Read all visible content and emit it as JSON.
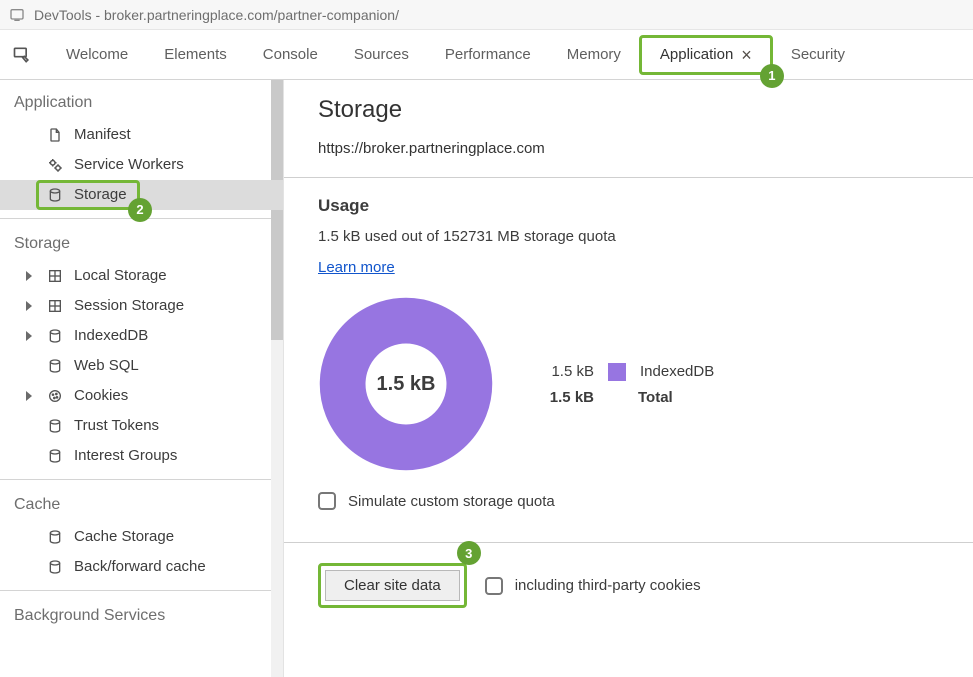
{
  "window": {
    "title": "DevTools - broker.partneringplace.com/partner-companion/"
  },
  "tabs": {
    "items": [
      {
        "label": "Welcome"
      },
      {
        "label": "Elements"
      },
      {
        "label": "Console"
      },
      {
        "label": "Sources"
      },
      {
        "label": "Performance"
      },
      {
        "label": "Memory"
      },
      {
        "label": "Application"
      },
      {
        "label": "Security"
      }
    ]
  },
  "badges": {
    "b1": "1",
    "b2": "2",
    "b3": "3"
  },
  "sidebar": {
    "application": {
      "heading": "Application",
      "items": [
        {
          "label": "Manifest"
        },
        {
          "label": "Service Workers"
        },
        {
          "label": "Storage"
        }
      ]
    },
    "storage": {
      "heading": "Storage",
      "items": [
        {
          "label": "Local Storage"
        },
        {
          "label": "Session Storage"
        },
        {
          "label": "IndexedDB"
        },
        {
          "label": "Web SQL"
        },
        {
          "label": "Cookies"
        },
        {
          "label": "Trust Tokens"
        },
        {
          "label": "Interest Groups"
        }
      ]
    },
    "cache": {
      "heading": "Cache",
      "items": [
        {
          "label": "Cache Storage"
        },
        {
          "label": "Back/forward cache"
        }
      ]
    },
    "background": {
      "heading": "Background Services"
    }
  },
  "panel": {
    "title": "Storage",
    "origin": "https://broker.partneringplace.com",
    "usage_heading": "Usage",
    "usage_line": "1.5 kB used out of 152731 MB storage quota",
    "learn_more": "Learn more",
    "donut_center": "1.5 kB",
    "legend": [
      {
        "value": "1.5 kB",
        "name": "IndexedDB"
      }
    ],
    "total_value": "1.5 kB",
    "total_label": "Total",
    "simulate_label": "Simulate custom storage quota",
    "clear_button": "Clear site data",
    "third_party_label": "including third-party cookies"
  },
  "chart_data": {
    "type": "pie",
    "title": "Storage usage",
    "categories": [
      "IndexedDB"
    ],
    "values": [
      1.5
    ],
    "unit": "kB",
    "total": "1.5 kB"
  }
}
